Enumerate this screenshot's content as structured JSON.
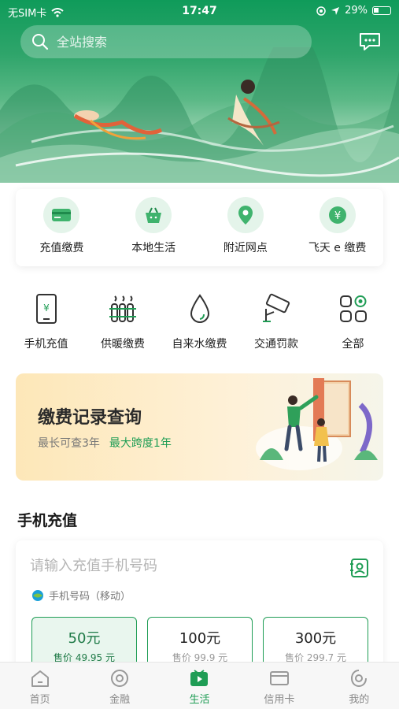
{
  "status_bar": {
    "carrier": "无SIM卡",
    "time": "17:47",
    "battery": "29%"
  },
  "search": {
    "placeholder": "全站搜索"
  },
  "quick_services": [
    {
      "label": "充值缴费",
      "icon": "card-icon"
    },
    {
      "label": "本地生活",
      "icon": "basket-icon"
    },
    {
      "label": "附近网点",
      "icon": "location-pin-icon"
    },
    {
      "label": "飞天 e 缴费",
      "icon": "yuan-coin-icon"
    }
  ],
  "services": [
    {
      "label": "手机充值",
      "icon": "phone-yuan-icon"
    },
    {
      "label": "供暖缴费",
      "icon": "radiator-icon"
    },
    {
      "label": "自来水缴费",
      "icon": "water-drop-icon"
    },
    {
      "label": "交通罚款",
      "icon": "traffic-camera-icon"
    },
    {
      "label": "全部",
      "icon": "grid-icon"
    }
  ],
  "promo": {
    "title": "缴费记录查询",
    "sub1": "最长可查3年",
    "sub2": "最大跨度1年"
  },
  "recharge": {
    "section_title": "手机充值",
    "placeholder": "请输入充值手机号码",
    "carrier_label": "手机号码（移动）",
    "amounts": [
      {
        "value": "50元",
        "price": "售价 49.95 元",
        "selected": true
      },
      {
        "value": "100元",
        "price": "售价 99.9 元",
        "selected": false
      },
      {
        "value": "300元",
        "price": "售价 299.7 元",
        "selected": false
      }
    ]
  },
  "tabbar": [
    {
      "label": "首页",
      "icon": "home-icon",
      "active": false
    },
    {
      "label": "金融",
      "icon": "finance-icon",
      "active": false
    },
    {
      "label": "生活",
      "icon": "life-play-icon",
      "active": true
    },
    {
      "label": "信用卡",
      "icon": "credit-card-icon",
      "active": false
    },
    {
      "label": "我的",
      "icon": "profile-icon",
      "active": false
    }
  ],
  "colors": {
    "primary_green": "#1f9d55",
    "banner_green": "#0f9b5a",
    "promo_bg": "#fde7b8"
  }
}
